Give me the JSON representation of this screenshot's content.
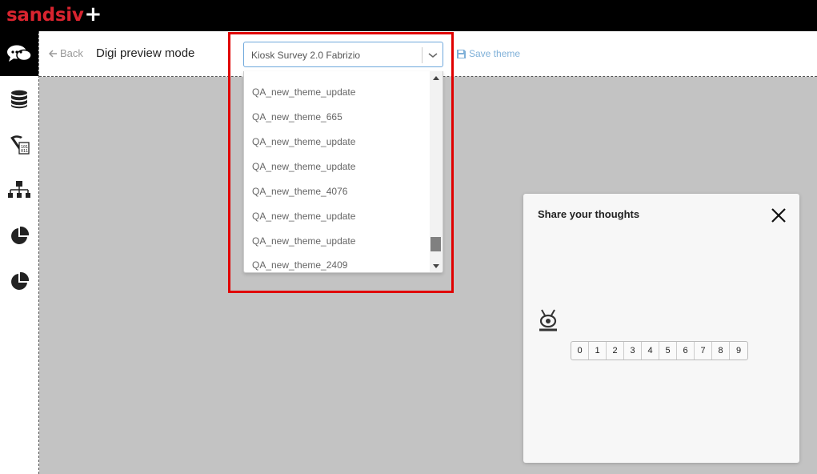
{
  "brand": {
    "name": "sandsiv",
    "plus": "+",
    "accent": "#d9242f"
  },
  "sidebar": {
    "items": [
      {
        "icon": "chat-bubbles-icon",
        "active": true
      },
      {
        "icon": "database-icon",
        "active": false
      },
      {
        "icon": "pickaxe-data-icon",
        "active": false
      },
      {
        "icon": "hierarchy-icon",
        "active": false
      },
      {
        "icon": "pie-chart-icon",
        "active": false
      },
      {
        "icon": "pie-chart-icon",
        "active": false
      }
    ]
  },
  "header": {
    "back_label": "Back",
    "title": "Digi preview mode",
    "theme_select": {
      "value": "Kiosk Survey 2.0 Fabrizio",
      "options": [
        "QA_new_theme_update",
        "QA_new_theme_665",
        "QA_new_theme_update",
        "QA_new_theme_update",
        "QA_new_theme_4076",
        "QA_new_theme_update",
        "QA_new_theme_update",
        "QA_new_theme_2409"
      ]
    },
    "save_label": "Save theme"
  },
  "widget": {
    "title": "Share your thoughts",
    "scale": [
      "0",
      "1",
      "2",
      "3",
      "4",
      "5",
      "6",
      "7",
      "8",
      "9"
    ]
  },
  "colors": {
    "highlight": "#e00000",
    "link": "#7fb0d8"
  }
}
